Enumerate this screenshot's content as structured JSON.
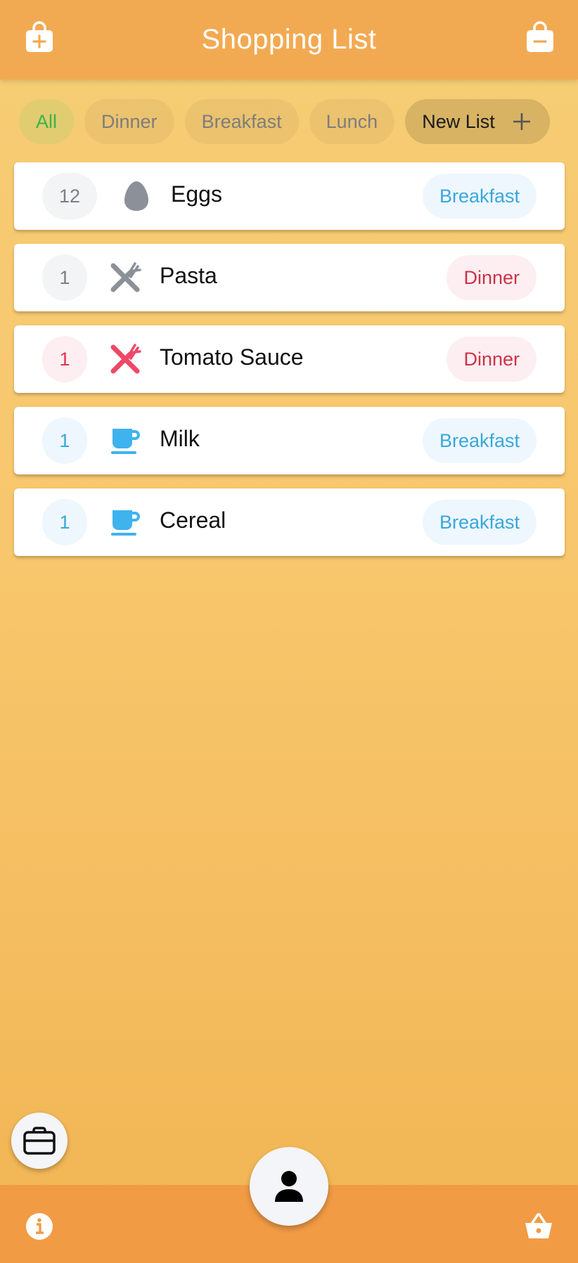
{
  "header": {
    "title": "Shopping List",
    "left_icon": "bag-plus-icon",
    "right_icon": "bag-minus-icon"
  },
  "filters": {
    "chips": [
      {
        "label": "All",
        "active": true
      },
      {
        "label": "Dinner",
        "active": false
      },
      {
        "label": "Breakfast",
        "active": false
      },
      {
        "label": "Lunch",
        "active": false
      }
    ],
    "new_list_label": "New List"
  },
  "items": [
    {
      "qty": "12",
      "name": "Eggs",
      "tag": "Breakfast",
      "icon": "egg-icon"
    },
    {
      "qty": "1",
      "name": "Pasta",
      "tag": "Dinner",
      "icon": "utensils-icon"
    },
    {
      "qty": "1",
      "name": "Tomato Sauce",
      "tag": "Dinner",
      "icon": "utensils-icon"
    },
    {
      "qty": "1",
      "name": "Milk",
      "tag": "Breakfast",
      "icon": "cup-icon"
    },
    {
      "qty": "1",
      "name": "Cereal",
      "tag": "Breakfast",
      "icon": "cup-icon"
    }
  ],
  "footer": {
    "left_icon": "info-icon",
    "right_icon": "basket-icon",
    "fab_icon": "user-icon",
    "floating_icon": "briefcase-icon"
  },
  "colors": {
    "header": "#f2aa52",
    "footer": "#f19b45",
    "accent_green": "#3cb34a",
    "breakfast_blue": "#3aa7dd",
    "dinner_red": "#cc3347"
  }
}
